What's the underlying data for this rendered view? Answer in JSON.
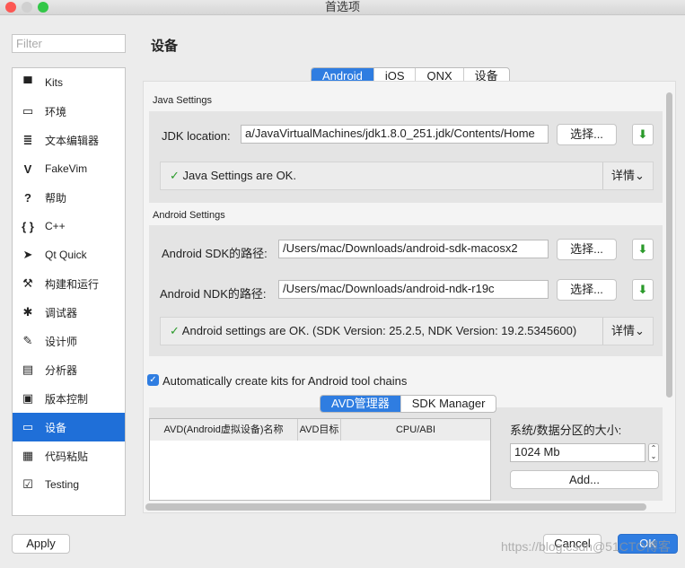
{
  "window": {
    "title": "首选项"
  },
  "filter": {
    "placeholder": "Filter"
  },
  "sidebar": {
    "items": [
      {
        "label": "Kits",
        "icon": "kits-icon",
        "glyph": "▀"
      },
      {
        "label": "环境",
        "icon": "monitor-icon",
        "glyph": "▭"
      },
      {
        "label": "文本编辑器",
        "icon": "text-editor-icon",
        "glyph": "≣"
      },
      {
        "label": "FakeVim",
        "icon": "fakevim-icon",
        "glyph": "V"
      },
      {
        "label": "帮助",
        "icon": "help-icon",
        "glyph": "?"
      },
      {
        "label": "C++",
        "icon": "braces-icon",
        "glyph": "{ }"
      },
      {
        "label": "Qt Quick",
        "icon": "qt-quick-icon",
        "glyph": "➤"
      },
      {
        "label": "构建和运行",
        "icon": "hammer-icon",
        "glyph": "⚒"
      },
      {
        "label": "调试器",
        "icon": "bug-icon",
        "glyph": "✱"
      },
      {
        "label": "设计师",
        "icon": "pen-icon",
        "glyph": "✎"
      },
      {
        "label": "分析器",
        "icon": "analyzer-icon",
        "glyph": "▤"
      },
      {
        "label": "版本控制",
        "icon": "version-control-icon",
        "glyph": "▣"
      },
      {
        "label": "设备",
        "icon": "device-icon",
        "glyph": "▭"
      },
      {
        "label": "代码粘贴",
        "icon": "paste-icon",
        "glyph": "▦"
      },
      {
        "label": "Testing",
        "icon": "testing-icon",
        "glyph": "☑"
      }
    ],
    "selected": 12
  },
  "page": {
    "title": "设备",
    "tabs": [
      "Android",
      "iOS",
      "QNX",
      "设备"
    ],
    "active_tab": 0
  },
  "java": {
    "group": "Java Settings",
    "jdk_label": "JDK location:",
    "jdk_value": "a/JavaVirtualMachines/jdk1.8.0_251.jdk/Contents/Home",
    "browse": "选择...",
    "status": "Java Settings are OK.",
    "details": "详情"
  },
  "android": {
    "group": "Android Settings",
    "sdk_label": "Android SDK的路径:",
    "sdk_value": "/Users/mac/Downloads/android-sdk-macosx2",
    "ndk_label": "Android NDK的路径:",
    "ndk_value": "/Users/mac/Downloads/android-ndk-r19c",
    "browse": "选择...",
    "status": "Android settings are OK. (SDK Version: 25.2.5, NDK Version: 19.2.5345600)",
    "details": "详情"
  },
  "auto_kits": {
    "label": "Automatically create kits for Android tool chains",
    "checked": true
  },
  "avd": {
    "tabs": [
      "AVD管理器",
      "SDK Manager"
    ],
    "active_tab": 0,
    "columns": [
      "AVD(Android虚拟设备)名称",
      "AVD目标",
      "CPU/ABI"
    ],
    "partition_label": "系统/数据分区的大小:",
    "partition_value": "1024 Mb",
    "add": "Add..."
  },
  "footer": {
    "apply": "Apply",
    "cancel": "Cancel",
    "ok": "OK"
  },
  "watermark": "https://blog.csdn@51CTO博客",
  "colors": {
    "accent": "#1f6fd8",
    "ok": "#2a9a2a"
  }
}
